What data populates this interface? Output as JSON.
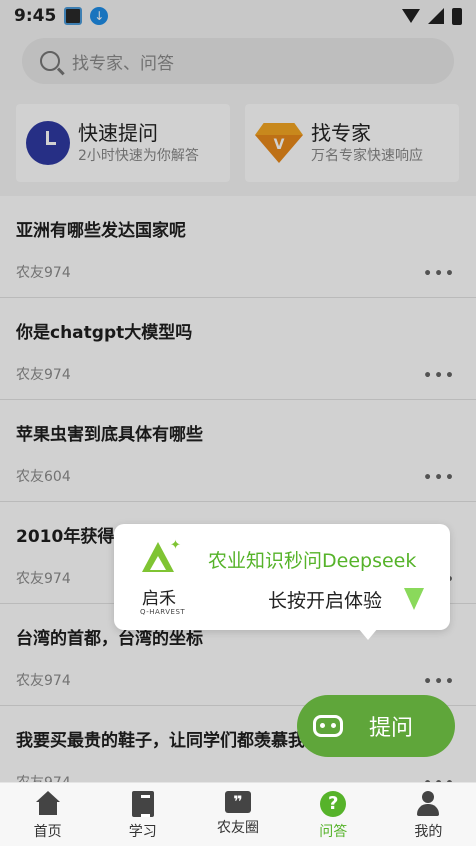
{
  "status_bar": {
    "time": "9:45"
  },
  "search": {
    "placeholder": "找专家、问答"
  },
  "quick_actions": [
    {
      "title": "快速提问",
      "subtitle": "2小时快速为你解答",
      "icon": "clock-icon",
      "icon_color": "#2f3aa3"
    },
    {
      "title": "找专家",
      "subtitle": "万名专家快速响应",
      "icon": "gem-icon",
      "icon_color": "#f5a623",
      "icon_letter": "V"
    }
  ],
  "questions": [
    {
      "title": "亚洲有哪些发达国家呢",
      "author": "农友974"
    },
    {
      "title": "你是chatgpt大模型吗",
      "author": "农友974"
    },
    {
      "title": "苹果虫害到底具体有哪些",
      "author": "农友604"
    },
    {
      "title": "2010年获得诺贝尔和平奖的人物是谁",
      "author": "农友974"
    },
    {
      "title": "台湾的首都，台湾的坐标",
      "author": "农友974"
    },
    {
      "title": "我要买最贵的鞋子，让同学们都羡慕我",
      "author": "农友974"
    }
  ],
  "promo_popup": {
    "brand_name": "启禾",
    "brand_sub": "Q-HARVEST",
    "line1": "农业知识秒问Deepseek",
    "line2": "长按开启体验",
    "accent_color": "#56b32a"
  },
  "fab": {
    "label": "提问",
    "color": "#5fa63a"
  },
  "bottom_nav": [
    {
      "label": "首页",
      "icon": "home-icon",
      "active": false
    },
    {
      "label": "学习",
      "icon": "book-icon",
      "active": false
    },
    {
      "label": "农友圈",
      "icon": "chat-icon",
      "active": false
    },
    {
      "label": "问答",
      "icon": "help-icon",
      "active": true
    },
    {
      "label": "我的",
      "icon": "user-icon",
      "active": false
    }
  ],
  "more_glyph": "•••",
  "chat_glyph": "❞",
  "help_glyph": "?"
}
